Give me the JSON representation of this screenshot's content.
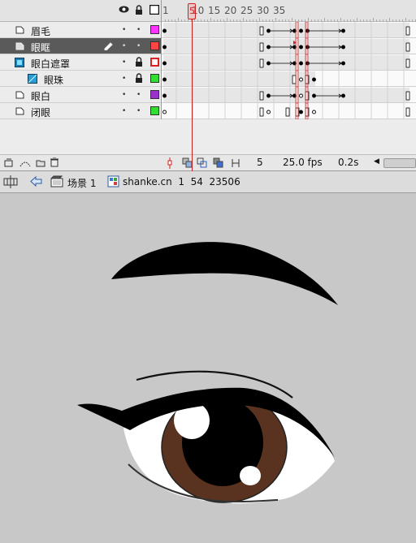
{
  "timeline": {
    "ruler_labels": [
      "1",
      "5",
      "10",
      "15",
      "20",
      "25",
      "30",
      "35"
    ],
    "current_frame_marker": "5",
    "layers": [
      {
        "name": "眉毛",
        "type": "normal",
        "selected": false,
        "locked": false,
        "outline_color": "#ff33ff",
        "outline_filled": true
      },
      {
        "name": "眼眶",
        "type": "normal",
        "selected": true,
        "locked": false,
        "outline_color": "#ff4444",
        "outline_filled": true
      },
      {
        "name": "眼白遮罩",
        "type": "mask",
        "selected": false,
        "locked": true,
        "outline_color": "#e02020",
        "outline_filled": false
      },
      {
        "name": "眼珠",
        "type": "masked",
        "selected": false,
        "locked": true,
        "outline_color": "#33dd33",
        "outline_filled": true
      },
      {
        "name": "眼白",
        "type": "normal",
        "selected": false,
        "locked": false,
        "outline_color": "#9933cc",
        "outline_filled": true
      },
      {
        "name": "闭眼",
        "type": "normal",
        "selected": false,
        "locked": false,
        "outline_color": "#33dd33",
        "outline_filled": true
      }
    ],
    "status": {
      "current_frame": "5",
      "frame_rate": "25.0 fps",
      "elapsed_time": "0.2s"
    }
  },
  "editbar": {
    "scene_label": "场景 1",
    "symbol_label": "shanke.cn  1  54  23506"
  },
  "icons": {
    "eye": "eye-icon",
    "lock": "lock-icon",
    "outline": "outline-icon",
    "pencil": "pencil-icon",
    "back": "back-arrow-icon",
    "scene": "scene-icon",
    "symbol": "symbol-icon"
  },
  "colors": {
    "stage_background": "#c8c8c8",
    "playhead": "#c62020",
    "iris": "#5a3320",
    "selected_layer": "#5a5a5a"
  }
}
